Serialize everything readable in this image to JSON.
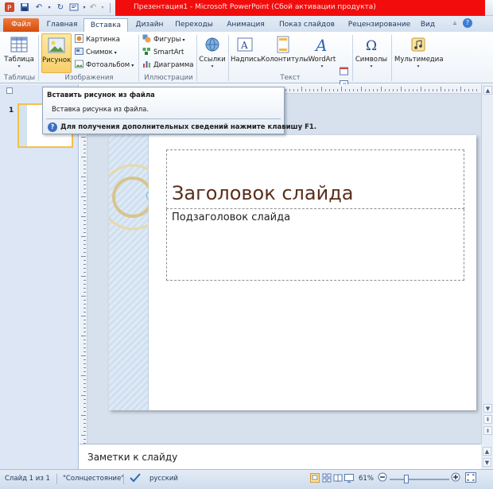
{
  "window": {
    "title": "Презентация1  -  Microsoft PowerPoint (Сбой активации продукта)"
  },
  "tabs": [
    {
      "label": "Файл"
    },
    {
      "label": "Главная"
    },
    {
      "label": "Вставка"
    },
    {
      "label": "Дизайн"
    },
    {
      "label": "Переходы"
    },
    {
      "label": "Анимация"
    },
    {
      "label": "Показ слайдов"
    },
    {
      "label": "Рецензирование"
    },
    {
      "label": "Вид"
    }
  ],
  "ribbon": {
    "tables": {
      "table_label": "Таблица",
      "group_label": "Таблицы"
    },
    "images": {
      "picture_label": "Рисунок",
      "clipart_label": "Картинка",
      "screenshot_label": "Снимок",
      "album_label": "Фотоальбом",
      "group_label": "Изображения"
    },
    "illustrations": {
      "shapes_label": "Фигуры",
      "smartart_label": "SmartArt",
      "chart_label": "Диаграмма",
      "group_label": "Иллюстрации"
    },
    "links": {
      "links_label": "Ссылки"
    },
    "text": {
      "textbox_label": "Надпись",
      "headerfooter_label": "Колонтитулы",
      "wordart_label": "WordArt",
      "group_label": "Текст"
    },
    "symbols": {
      "symbols_label": "Символы"
    },
    "media": {
      "media_label": "Мультимедиа"
    }
  },
  "tooltip": {
    "title": "Вставить рисунок из файла",
    "description": "Вставка рисунка из файла.",
    "help_text": "Для получения дополнительных сведений нажмите клавишу F1."
  },
  "slides_pane": {
    "thumb_number": "1"
  },
  "slide": {
    "title": "Заголовок слайда",
    "subtitle": "Подзаголовок слайда"
  },
  "notes": {
    "placeholder": "Заметки к слайду"
  },
  "statusbar": {
    "slide_info": "Слайд 1 из 1",
    "theme": "\"Солнцестояние\"",
    "language": "русский",
    "zoom": "61%"
  },
  "colors": {
    "title_bar_alert": "#f20d0d",
    "file_tab": "#d44c0e",
    "selected_button": "#f8cf6a",
    "slide_title": "#5a2e1b"
  }
}
